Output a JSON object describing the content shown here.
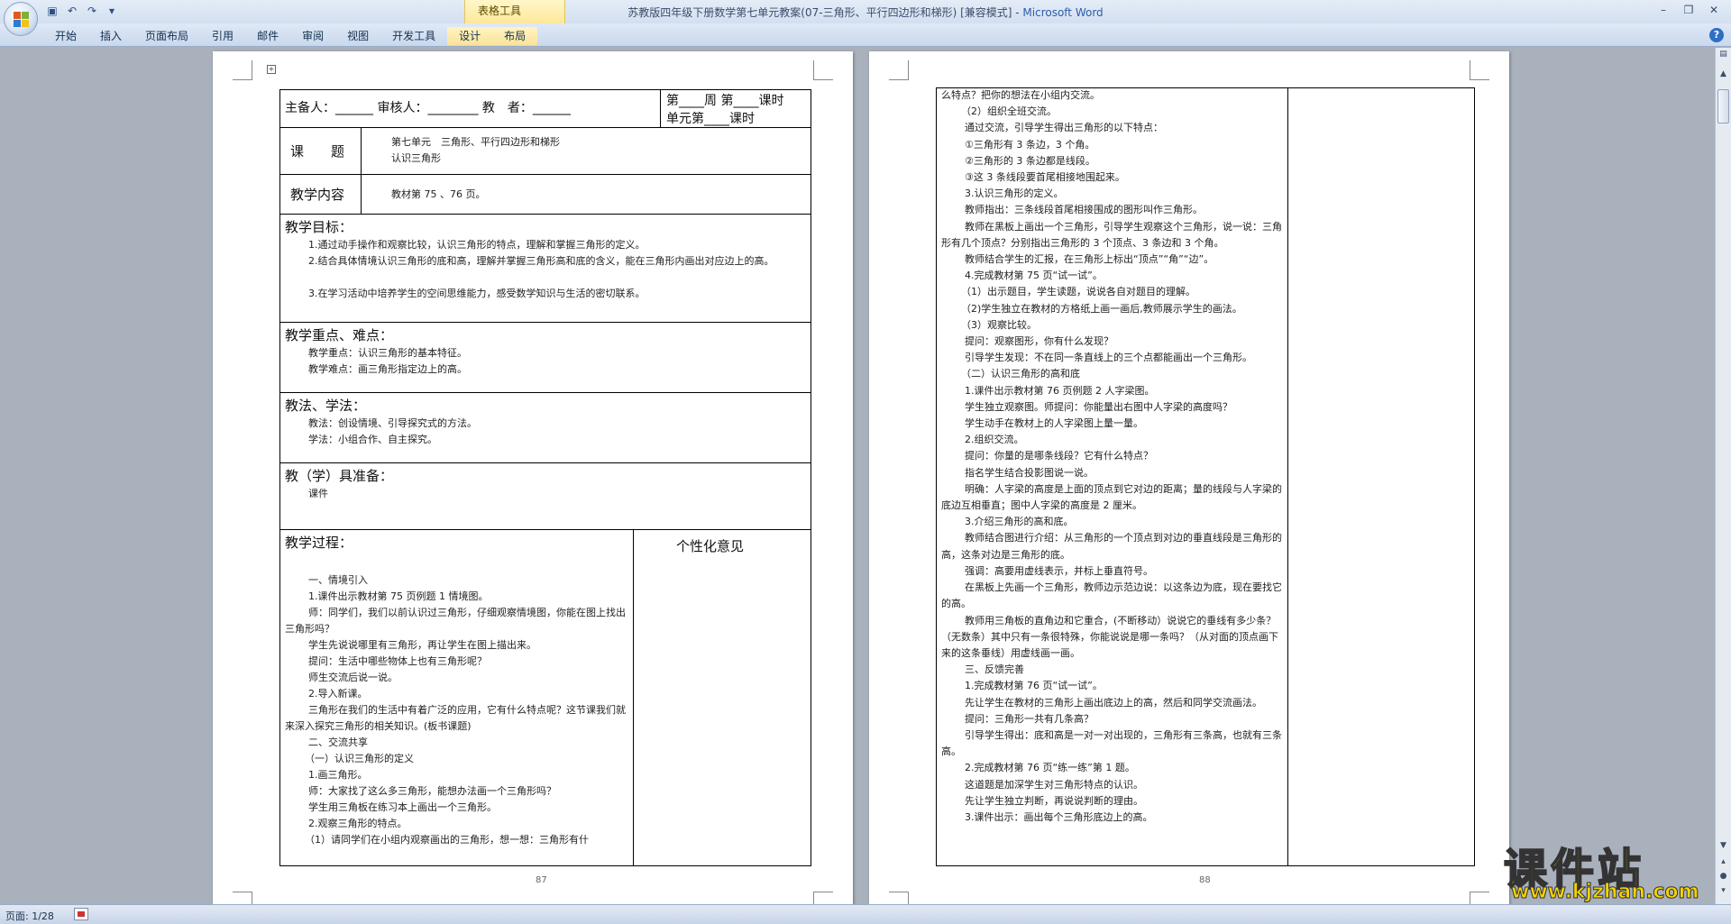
{
  "window": {
    "title": "苏教版四年级下册数学第七单元教案(07-三角形、平行四边形和梯形) [兼容模式] - ",
    "app": "Microsoft Word"
  },
  "ribbon": {
    "contextual_group": "表格工具",
    "tabs": [
      "开始",
      "插入",
      "页面布局",
      "引用",
      "邮件",
      "审阅",
      "视图",
      "开发工具",
      "设计",
      "布局"
    ]
  },
  "page1": {
    "header_left": "主备人：______ 审核人：________ 教　者：______",
    "header_right_1": "第____周 第____课时",
    "header_right_2": "单元第____课时",
    "topic_label": "课　　题",
    "topic_line1": "第七单元　三角形、平行四边形和梯形",
    "topic_line2": "认识三角形",
    "content_label": "教学内容",
    "content_value": "教材第 75 、76 页。",
    "goals_label": "教学目标：",
    "goals": [
      "1.通过动手操作和观察比较，认识三角形的特点，理解和掌握三角形的定义。",
      "2.结合具体情境认识三角形的底和高，理解并掌握三角形高和底的含义，能在三角形内画出对应边上的高。",
      "3.在学习活动中培养学生的空间思维能力，感受数学知识与生活的密切联系。"
    ],
    "keypoints_label": "教学重点、难点：",
    "keypoints": [
      "教学重点：认识三角形的基本特征。",
      "教学难点：画三角形指定边上的高。"
    ],
    "methods_label": "教法、学法：",
    "methods": [
      "教法：创设情境、引导探究式的方法。",
      "学法：小组合作、自主探究。"
    ],
    "prep_label": "教（学）具准备：",
    "prep_value": "课件",
    "process_label": "教学过程：",
    "personal_label": "个性化意见",
    "process": [
      "一、情境引入",
      "1.课件出示教材第 75 页例题 1 情境图。",
      "师：同学们，我们以前认识过三角形，仔细观察情境图，你能在图上找出三角形吗？",
      "学生先说说哪里有三角形，再让学生在图上描出来。",
      "提问：生活中哪些物体上也有三角形呢？",
      "师生交流后说一说。",
      "2.导入新课。",
      "三角形在我们的生活中有着广泛的应用，它有什么特点呢？这节课我们就来深入探究三角形的相关知识。(板书课题)",
      "二、交流共享",
      "（一）认识三角形的定义",
      "1.画三角形。",
      "师：大家找了这么多三角形，能想办法画一个三角形吗？",
      "学生用三角板在练习本上画出一个三角形。",
      "2.观察三角形的特点。",
      "（1）请同学们在小组内观察画出的三角形，想一想：三角形有什"
    ],
    "page_number": "87"
  },
  "page2": {
    "lines": [
      "么特点？把你的想法在小组内交流。",
      "（2）组织全班交流。",
      "通过交流，引导学生得出三角形的以下特点：",
      "①三角形有 3 条边，3 个角。",
      "②三角形的 3 条边都是线段。",
      "③这 3 条线段要首尾相接地围起来。",
      "3.认识三角形的定义。",
      "教师指出：三条线段首尾相接围成的图形叫作三角形。",
      "教师在黑板上画出一个三角形，引导学生观察这个三角形，说一说：三角形有几个顶点？分别指出三角形的 3 个顶点、3 条边和 3 个角。",
      "教师结合学生的汇报，在三角形上标出“顶点”“角”“边”。",
      "4.完成教材第 75 页“试一试”。",
      "（1）出示题目，学生读题，说说各自对题目的理解。",
      "（2)学生独立在教材的方格纸上画一画后,教师展示学生的画法。",
      "（3）观察比较。",
      "提问：观察图形，你有什么发现？",
      "引导学生发现：不在同一条直线上的三个点都能画出一个三角形。",
      "（二）认识三角形的高和底",
      "1.课件出示教材第 76 页例题 2 人字梁图。",
      "学生独立观察图。师提问：你能量出右图中人字梁的高度吗？",
      "学生动手在教材上的人字梁图上量一量。",
      "2.组织交流。",
      "提问：你量的是哪条线段？它有什么特点？",
      "指名学生结合投影图说一说。",
      "明确：人字梁的高度是上面的顶点到它对边的距离；量的线段与人字梁的底边互相垂直；图中人字梁的高度是 2 厘米。",
      "3.介绍三角形的高和底。",
      "教师结合图进行介绍：从三角形的一个顶点到对边的垂直线段是三角形的高，这条对边是三角形的底。",
      "强调：高要用虚线表示，并标上垂直符号。",
      "在黑板上先画一个三角形，教师边示范边说：以这条边为底，现在要找它的高。",
      "教师用三角板的直角边和它重合，(不断移动）说说它的垂线有多少条？（无数条）其中只有一条很特殊，你能说说是哪一条吗？（从对面的顶点画下来的这条垂线）用虚线画一画。",
      "三、反馈完善",
      "1.完成教材第 76 页“试一试”。",
      "先让学生在教材的三角形上画出底边上的高，然后和同学交流画法。",
      "提问：三角形一共有几条高？",
      "引导学生得出：底和高是一对一对出现的，三角形有三条高，也就有三条高。",
      "2.完成教材第 76 页“练一练”第 1 题。",
      "这道题是加深学生对三角形特点的认识。",
      "先让学生独立判断，再说说判断的理由。",
      "3.课件出示：画出每个三角形底边上的高。"
    ],
    "page_number": "88"
  },
  "status": {
    "page": "页面: 1/28"
  },
  "watermark": {
    "main": "课件站",
    "sub": "www.kjzhan.com"
  },
  "icons": {
    "office_button": "office-logo-icon",
    "save": "save-icon",
    "undo": "undo-icon",
    "redo": "redo-icon",
    "help": "help-icon"
  }
}
